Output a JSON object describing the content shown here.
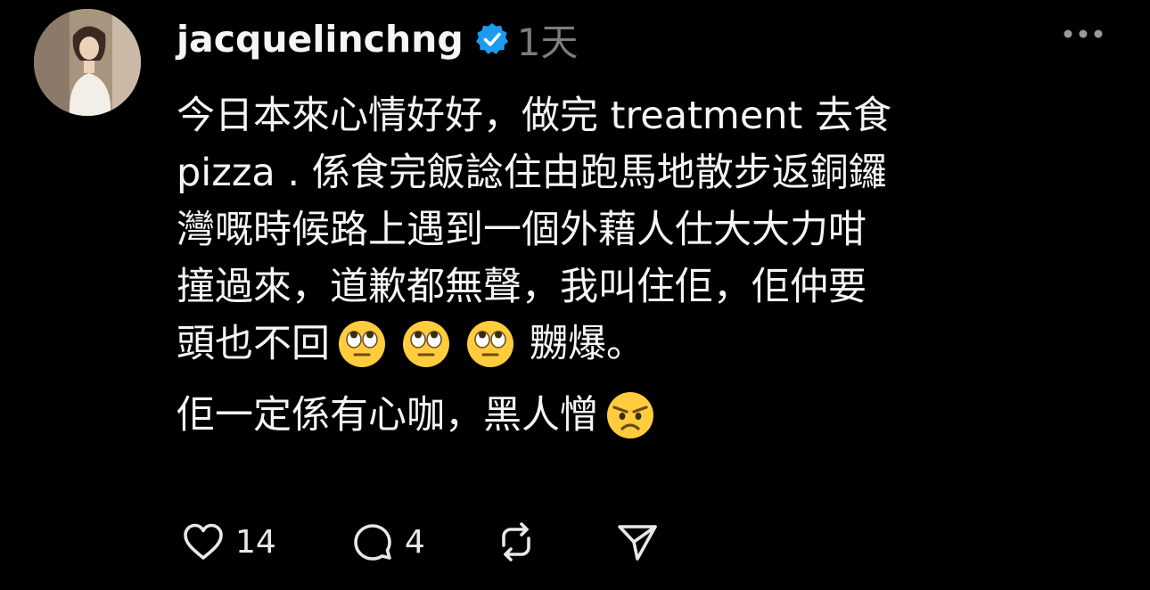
{
  "post": {
    "username": "jacquelinchng",
    "time": "1天",
    "lines": [
      "今日本來心情好好，做完 treatment 去食",
      " pizza . 係食完飯諗住由跑馬地散步返銅鑼",
      "灣嘅時候路上遇到一個外藉人仕大大力咁",
      "撞過來，道歉都無聲，我叫住佢，佢仲要",
      "頭也不回",
      "嬲爆。",
      "佢一定係有心咖，黑人憎"
    ],
    "emoji": {
      "eye_roll": "face-with-rolling-eyes",
      "angry": "angry-face"
    }
  },
  "actions": {
    "likes": "14",
    "comments": "4"
  },
  "colors": {
    "background": "#000000",
    "text": "#f5f5f5",
    "muted": "#7d7d7d",
    "verified": "#1d9bf0",
    "emoji": "#ffcc3e"
  }
}
